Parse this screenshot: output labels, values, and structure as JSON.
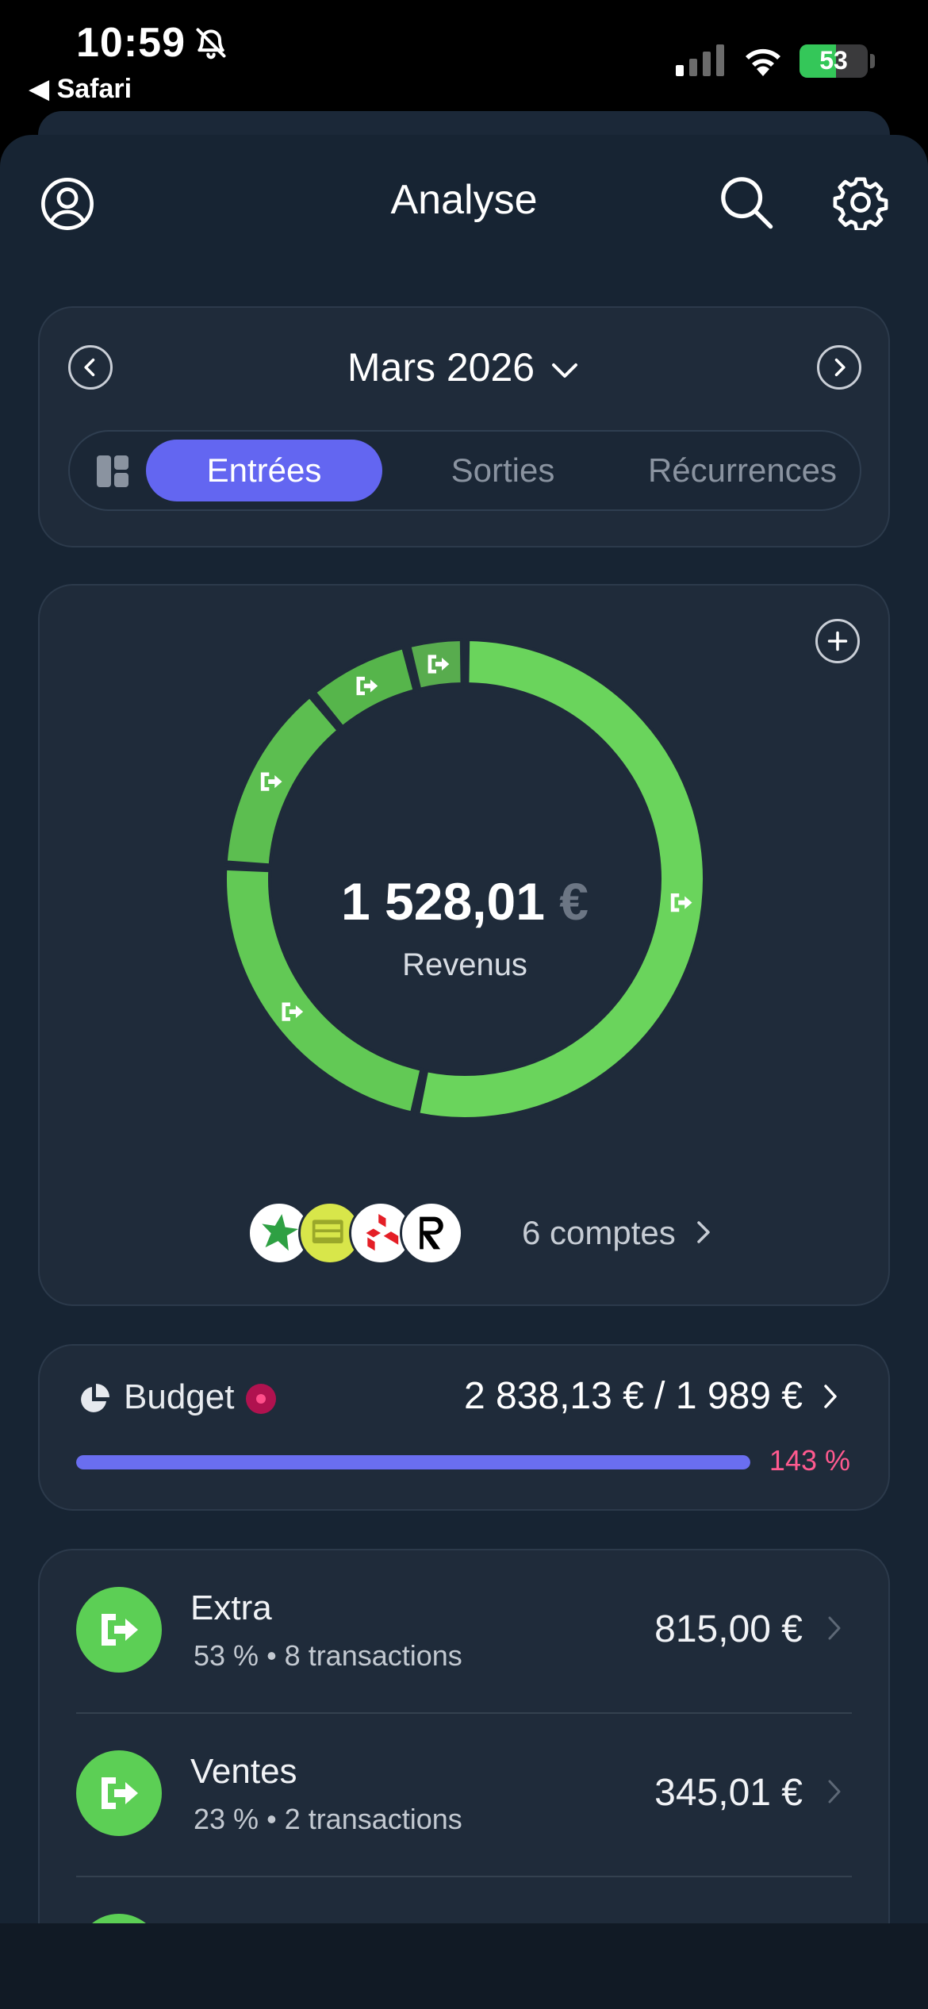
{
  "status_bar": {
    "time": "10:59",
    "back_app": "◀ Safari",
    "battery": "53",
    "battery_level": 0.53
  },
  "header": {
    "title": "Analyse"
  },
  "period": {
    "month": "Mars 2026",
    "tabs": [
      {
        "label": "Entrées",
        "active": true
      },
      {
        "label": "Sorties",
        "active": false
      },
      {
        "label": "Récurrences",
        "active": false
      }
    ]
  },
  "summary": {
    "amount": "1 528,01",
    "currency": "€",
    "label": "Revenus",
    "accounts_label": "6 comptes"
  },
  "chart_data": {
    "type": "pie",
    "style": "donut",
    "values": [
      815.0,
      345.01,
      200,
      108,
      60
    ],
    "colors": [
      "#6ad45c",
      "#62c955",
      "#5cbe50",
      "#56b54b",
      "#58ac4e"
    ]
  },
  "budget": {
    "label": "Budget",
    "amounts": "2 838,13 € / 1 989 €",
    "percent": "143 %",
    "progress": 1.0
  },
  "categories": [
    {
      "name": "Extra",
      "percent": "53 %",
      "transactions": "8 transactions",
      "amount": "815,00 €"
    },
    {
      "name": "Ventes",
      "percent": "23 %",
      "transactions": "2 transactions",
      "amount": "345,01 €"
    }
  ],
  "colors": {
    "accent": "#6366f1",
    "green": "#5ccf55",
    "alert": "#ff5a8f",
    "background": "#172433",
    "card": "#1f2b3a"
  }
}
